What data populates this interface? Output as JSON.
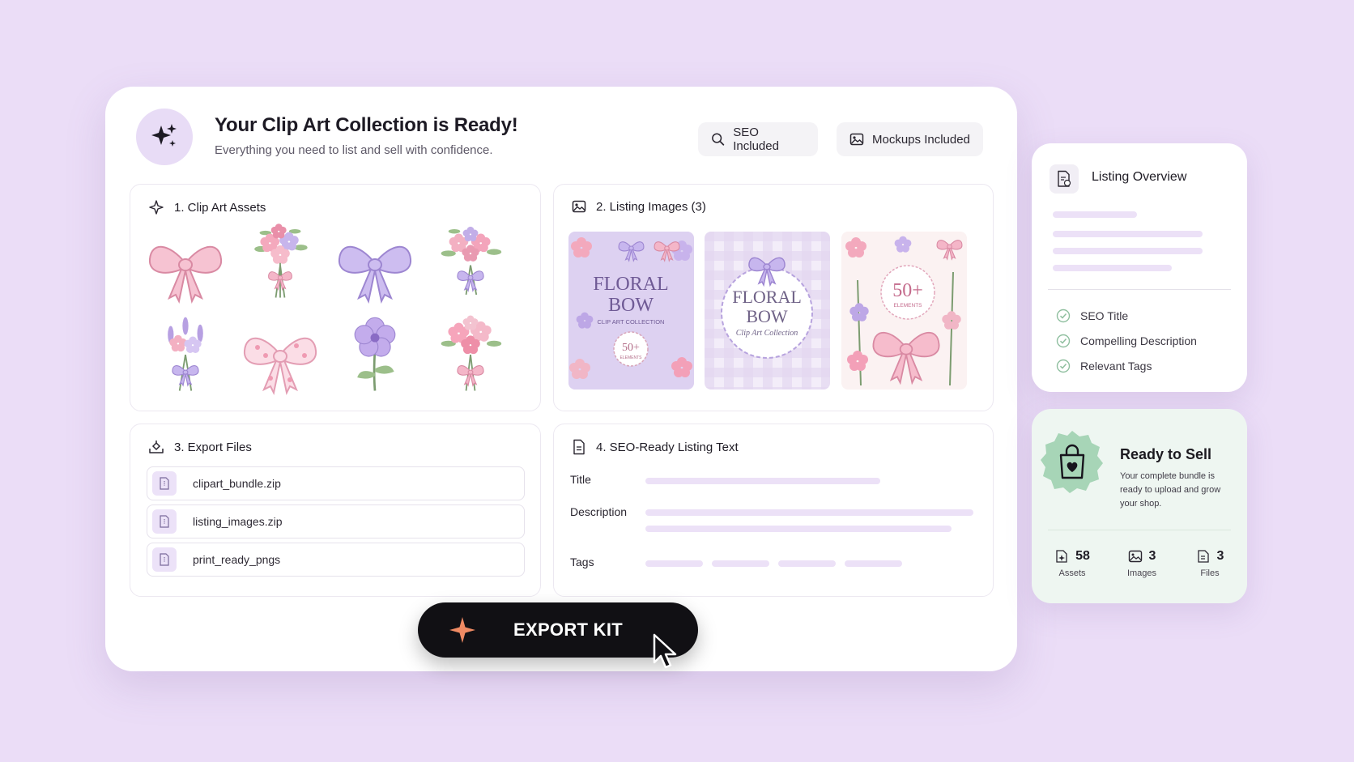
{
  "hero": {
    "title": "Your Clip Art Collection is Ready!",
    "subtitle": "Everything you need to list and sell with confidence.",
    "icon": "sparkle-icon"
  },
  "chips": {
    "seo": "SEO Included",
    "mockups": "Mockups Included"
  },
  "sections": {
    "assets": {
      "title": "1. Clip Art Assets",
      "items": [
        "pink-bow",
        "floral-bouquet-pink-bow",
        "lavender-bow",
        "lavender-bouquet-bow",
        "lavender-sprig-bouquet",
        "floral-pink-bow",
        "purple-flower",
        "pink-flower-bouquet"
      ]
    },
    "listing_images": {
      "title": "2. Listing Images (3)",
      "images": [
        {
          "title_line1": "FLORAL",
          "title_line2": "BOW",
          "subtitle": "CLIP ART COLLECTION",
          "badge_number": "50+",
          "badge_label": "ELEMENTS"
        },
        {
          "title_line1": "FLORAL",
          "title_line2": "BOW",
          "subtitle": "Clip Art Collection"
        },
        {
          "badge_number": "50+",
          "badge_label": "ELEMENTS"
        }
      ]
    },
    "export_files": {
      "title": "3. Export Files",
      "files": [
        "clipart_bundle.zip",
        "listing_images.zip",
        "print_ready_pngs"
      ]
    },
    "seo_text": {
      "title": "4. SEO-Ready Listing Text",
      "fields": {
        "title": "Title",
        "description": "Description",
        "tags": "Tags"
      }
    }
  },
  "export_button": {
    "label": "EXPORT KIT"
  },
  "overview": {
    "title": "Listing Overview",
    "checks": [
      "SEO Title",
      "Compelling Description",
      "Relevant Tags"
    ]
  },
  "ready": {
    "title": "Ready to Sell",
    "description": "Your complete bundle is ready to upload and grow your shop.",
    "stats": [
      {
        "value": "58",
        "label": "Assets"
      },
      {
        "value": "3",
        "label": "Images"
      },
      {
        "value": "3",
        "label": "Files"
      }
    ]
  },
  "colors": {
    "background": "#ebddf7",
    "accent_lavender": "#b9a3e0",
    "accent_pink": "#f2a7bd",
    "export_star": "#ef8a63",
    "ready_green": "#9ed0b1"
  }
}
